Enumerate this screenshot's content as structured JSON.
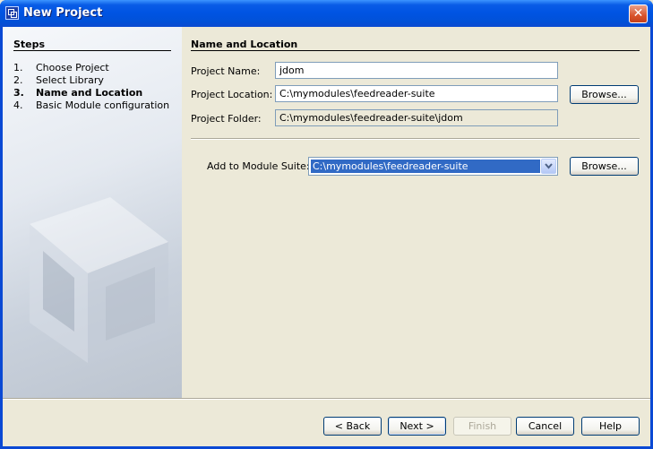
{
  "window": {
    "title": "New Project"
  },
  "steps": {
    "title": "Steps",
    "items": [
      {
        "num": "1.",
        "label": "Choose Project"
      },
      {
        "num": "2.",
        "label": "Select Library"
      },
      {
        "num": "3.",
        "label": "Name and Location"
      },
      {
        "num": "4.",
        "label": "Basic Module configuration"
      }
    ],
    "current_index": 2
  },
  "panel": {
    "title": "Name and Location",
    "project_name_label": "Project Name:",
    "project_name_value": "jdom",
    "project_location_label": "Project Location:",
    "project_location_value": "C:\\mymodules\\feedreader-suite",
    "project_folder_label": "Project Folder:",
    "project_folder_value": "C:\\mymodules\\feedreader-suite\\jdom",
    "browse_label": "Browse...",
    "module_suite_label": "Add to Module Suite:",
    "module_suite_value": "C:\\mymodules\\feedreader-suite",
    "browse2_label": "Browse..."
  },
  "buttons": {
    "back": "< Back",
    "next": "Next >",
    "finish": "Finish",
    "cancel": "Cancel",
    "help": "Help"
  },
  "colors": {
    "titlebar": "#0054e3",
    "selection": "#316ac5",
    "dialog_bg": "#ece9d8"
  },
  "icons": {
    "title": "netbeans-app-icon",
    "close": "close-icon",
    "combo": "chevron-down-icon"
  }
}
